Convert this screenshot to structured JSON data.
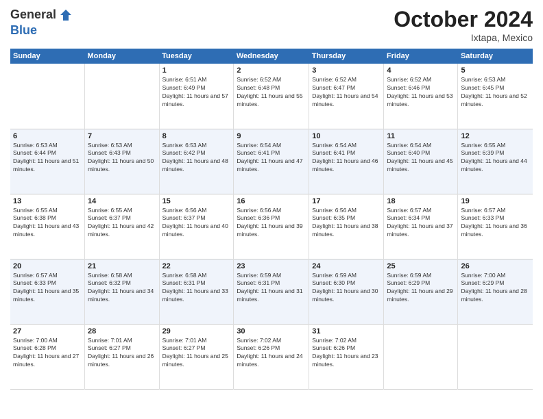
{
  "header": {
    "logo_line1": "General",
    "logo_line2": "Blue",
    "month": "October 2024",
    "location": "Ixtapa, Mexico"
  },
  "days_of_week": [
    "Sunday",
    "Monday",
    "Tuesday",
    "Wednesday",
    "Thursday",
    "Friday",
    "Saturday"
  ],
  "weeks": [
    [
      {
        "day": "",
        "info": ""
      },
      {
        "day": "",
        "info": ""
      },
      {
        "day": "1",
        "info": "Sunrise: 6:51 AM\nSunset: 6:49 PM\nDaylight: 11 hours and 57 minutes."
      },
      {
        "day": "2",
        "info": "Sunrise: 6:52 AM\nSunset: 6:48 PM\nDaylight: 11 hours and 55 minutes."
      },
      {
        "day": "3",
        "info": "Sunrise: 6:52 AM\nSunset: 6:47 PM\nDaylight: 11 hours and 54 minutes."
      },
      {
        "day": "4",
        "info": "Sunrise: 6:52 AM\nSunset: 6:46 PM\nDaylight: 11 hours and 53 minutes."
      },
      {
        "day": "5",
        "info": "Sunrise: 6:53 AM\nSunset: 6:45 PM\nDaylight: 11 hours and 52 minutes."
      }
    ],
    [
      {
        "day": "6",
        "info": "Sunrise: 6:53 AM\nSunset: 6:44 PM\nDaylight: 11 hours and 51 minutes."
      },
      {
        "day": "7",
        "info": "Sunrise: 6:53 AM\nSunset: 6:43 PM\nDaylight: 11 hours and 50 minutes."
      },
      {
        "day": "8",
        "info": "Sunrise: 6:53 AM\nSunset: 6:42 PM\nDaylight: 11 hours and 48 minutes."
      },
      {
        "day": "9",
        "info": "Sunrise: 6:54 AM\nSunset: 6:41 PM\nDaylight: 11 hours and 47 minutes."
      },
      {
        "day": "10",
        "info": "Sunrise: 6:54 AM\nSunset: 6:41 PM\nDaylight: 11 hours and 46 minutes."
      },
      {
        "day": "11",
        "info": "Sunrise: 6:54 AM\nSunset: 6:40 PM\nDaylight: 11 hours and 45 minutes."
      },
      {
        "day": "12",
        "info": "Sunrise: 6:55 AM\nSunset: 6:39 PM\nDaylight: 11 hours and 44 minutes."
      }
    ],
    [
      {
        "day": "13",
        "info": "Sunrise: 6:55 AM\nSunset: 6:38 PM\nDaylight: 11 hours and 43 minutes."
      },
      {
        "day": "14",
        "info": "Sunrise: 6:55 AM\nSunset: 6:37 PM\nDaylight: 11 hours and 42 minutes."
      },
      {
        "day": "15",
        "info": "Sunrise: 6:56 AM\nSunset: 6:37 PM\nDaylight: 11 hours and 40 minutes."
      },
      {
        "day": "16",
        "info": "Sunrise: 6:56 AM\nSunset: 6:36 PM\nDaylight: 11 hours and 39 minutes."
      },
      {
        "day": "17",
        "info": "Sunrise: 6:56 AM\nSunset: 6:35 PM\nDaylight: 11 hours and 38 minutes."
      },
      {
        "day": "18",
        "info": "Sunrise: 6:57 AM\nSunset: 6:34 PM\nDaylight: 11 hours and 37 minutes."
      },
      {
        "day": "19",
        "info": "Sunrise: 6:57 AM\nSunset: 6:33 PM\nDaylight: 11 hours and 36 minutes."
      }
    ],
    [
      {
        "day": "20",
        "info": "Sunrise: 6:57 AM\nSunset: 6:33 PM\nDaylight: 11 hours and 35 minutes."
      },
      {
        "day": "21",
        "info": "Sunrise: 6:58 AM\nSunset: 6:32 PM\nDaylight: 11 hours and 34 minutes."
      },
      {
        "day": "22",
        "info": "Sunrise: 6:58 AM\nSunset: 6:31 PM\nDaylight: 11 hours and 33 minutes."
      },
      {
        "day": "23",
        "info": "Sunrise: 6:59 AM\nSunset: 6:31 PM\nDaylight: 11 hours and 31 minutes."
      },
      {
        "day": "24",
        "info": "Sunrise: 6:59 AM\nSunset: 6:30 PM\nDaylight: 11 hours and 30 minutes."
      },
      {
        "day": "25",
        "info": "Sunrise: 6:59 AM\nSunset: 6:29 PM\nDaylight: 11 hours and 29 minutes."
      },
      {
        "day": "26",
        "info": "Sunrise: 7:00 AM\nSunset: 6:29 PM\nDaylight: 11 hours and 28 minutes."
      }
    ],
    [
      {
        "day": "27",
        "info": "Sunrise: 7:00 AM\nSunset: 6:28 PM\nDaylight: 11 hours and 27 minutes."
      },
      {
        "day": "28",
        "info": "Sunrise: 7:01 AM\nSunset: 6:27 PM\nDaylight: 11 hours and 26 minutes."
      },
      {
        "day": "29",
        "info": "Sunrise: 7:01 AM\nSunset: 6:27 PM\nDaylight: 11 hours and 25 minutes."
      },
      {
        "day": "30",
        "info": "Sunrise: 7:02 AM\nSunset: 6:26 PM\nDaylight: 11 hours and 24 minutes."
      },
      {
        "day": "31",
        "info": "Sunrise: 7:02 AM\nSunset: 6:26 PM\nDaylight: 11 hours and 23 minutes."
      },
      {
        "day": "",
        "info": ""
      },
      {
        "day": "",
        "info": ""
      }
    ]
  ]
}
